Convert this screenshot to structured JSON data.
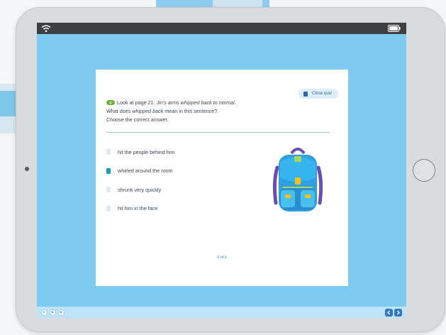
{
  "status_bar": {
    "wifi_icon": "wifi-icon",
    "battery_icon": "battery-icon"
  },
  "quiz": {
    "close_label": "Close quiz",
    "page_badge": "p",
    "question_line1_prefix": "Look at page 21: ",
    "question_line1_quote": "Jin's arms whipped back to normal.",
    "question_line2_prefix": "What does ",
    "question_line2_term": "whipped back",
    "question_line2_suffix": " mean in this sentence?",
    "instruction": "Choose the correct answer.",
    "answers": [
      {
        "label": "hit the people behind him",
        "selected": false
      },
      {
        "label": "whirled around the room",
        "selected": true
      },
      {
        "label": "shrunk very quickly",
        "selected": false
      },
      {
        "label": "hit him in the face",
        "selected": false
      }
    ],
    "page_counter": "6 of 6",
    "illustration": "backpack-illustration"
  },
  "bottom_bar": {
    "controls": [
      "play-icon",
      "stop-icon",
      "audio-icon"
    ],
    "navigation": [
      "previous-icon",
      "next-icon"
    ]
  },
  "colors": {
    "screen_background": "#7ecbf2",
    "selected_answer": "#1a9bbc",
    "unselected_answer": "#dbeaf5",
    "nav_button": "#2f76c5",
    "page_badge": "#6fb43a"
  }
}
